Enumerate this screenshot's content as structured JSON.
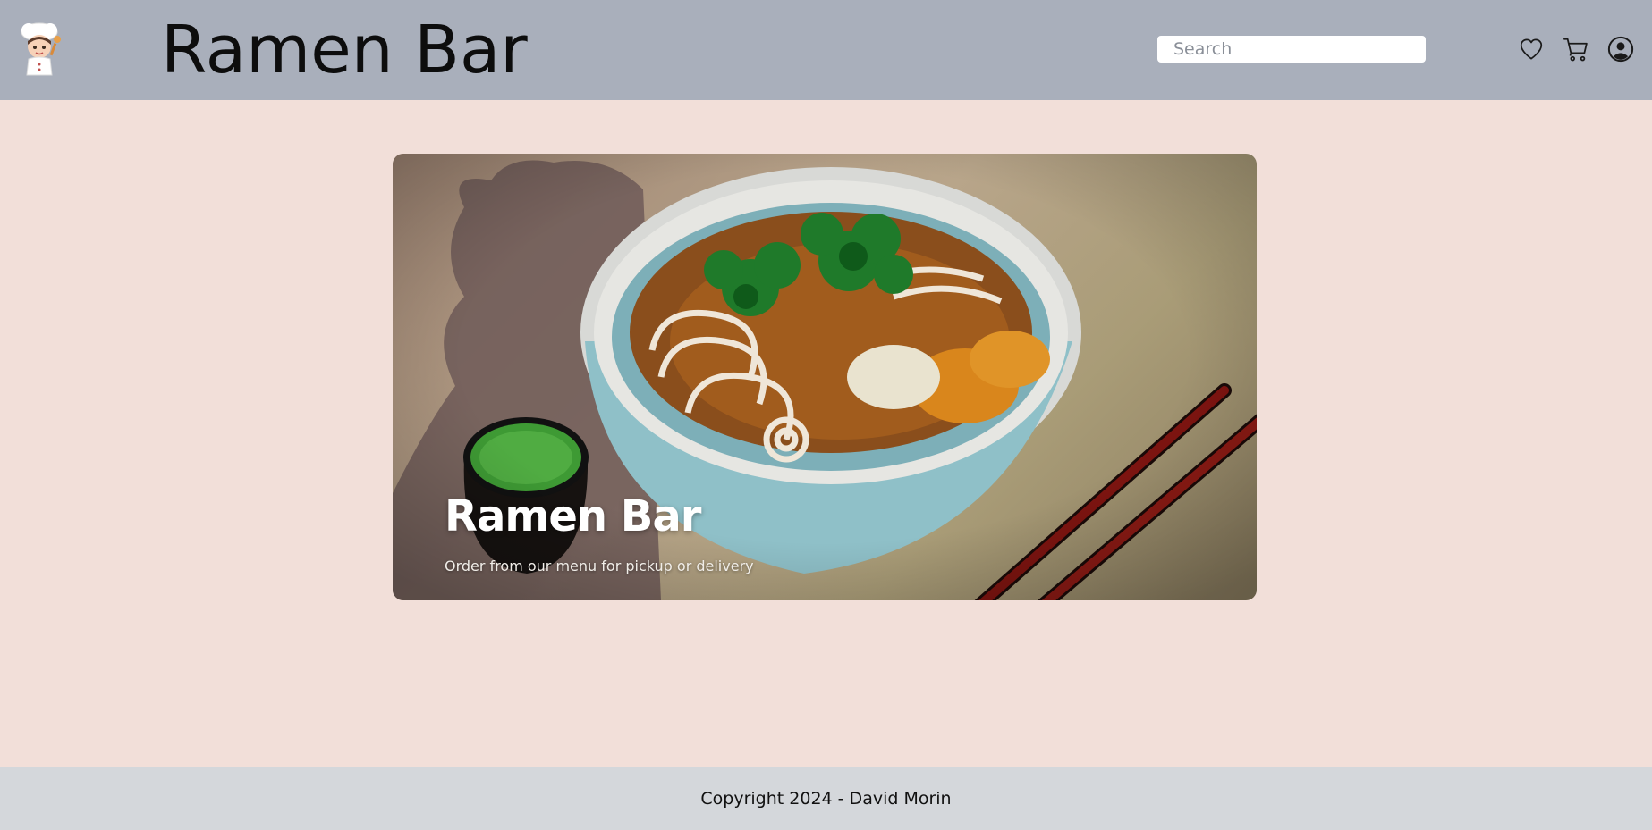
{
  "header": {
    "brand": "Ramen Bar",
    "logo_icon": "chef-mascot-icon",
    "search": {
      "placeholder": "Search",
      "value": ""
    },
    "icons": [
      "heart-icon",
      "cart-icon",
      "user-icon"
    ]
  },
  "hero": {
    "title": "Ramen Bar",
    "subtitle": "Order from our menu for pickup or delivery"
  },
  "footer": {
    "copyright": "Copyright 2024 - David Morin"
  },
  "colors": {
    "header_bg": "#a9afbb",
    "page_bg": "#f2dfd9",
    "footer_bg": "#d4d7db"
  }
}
